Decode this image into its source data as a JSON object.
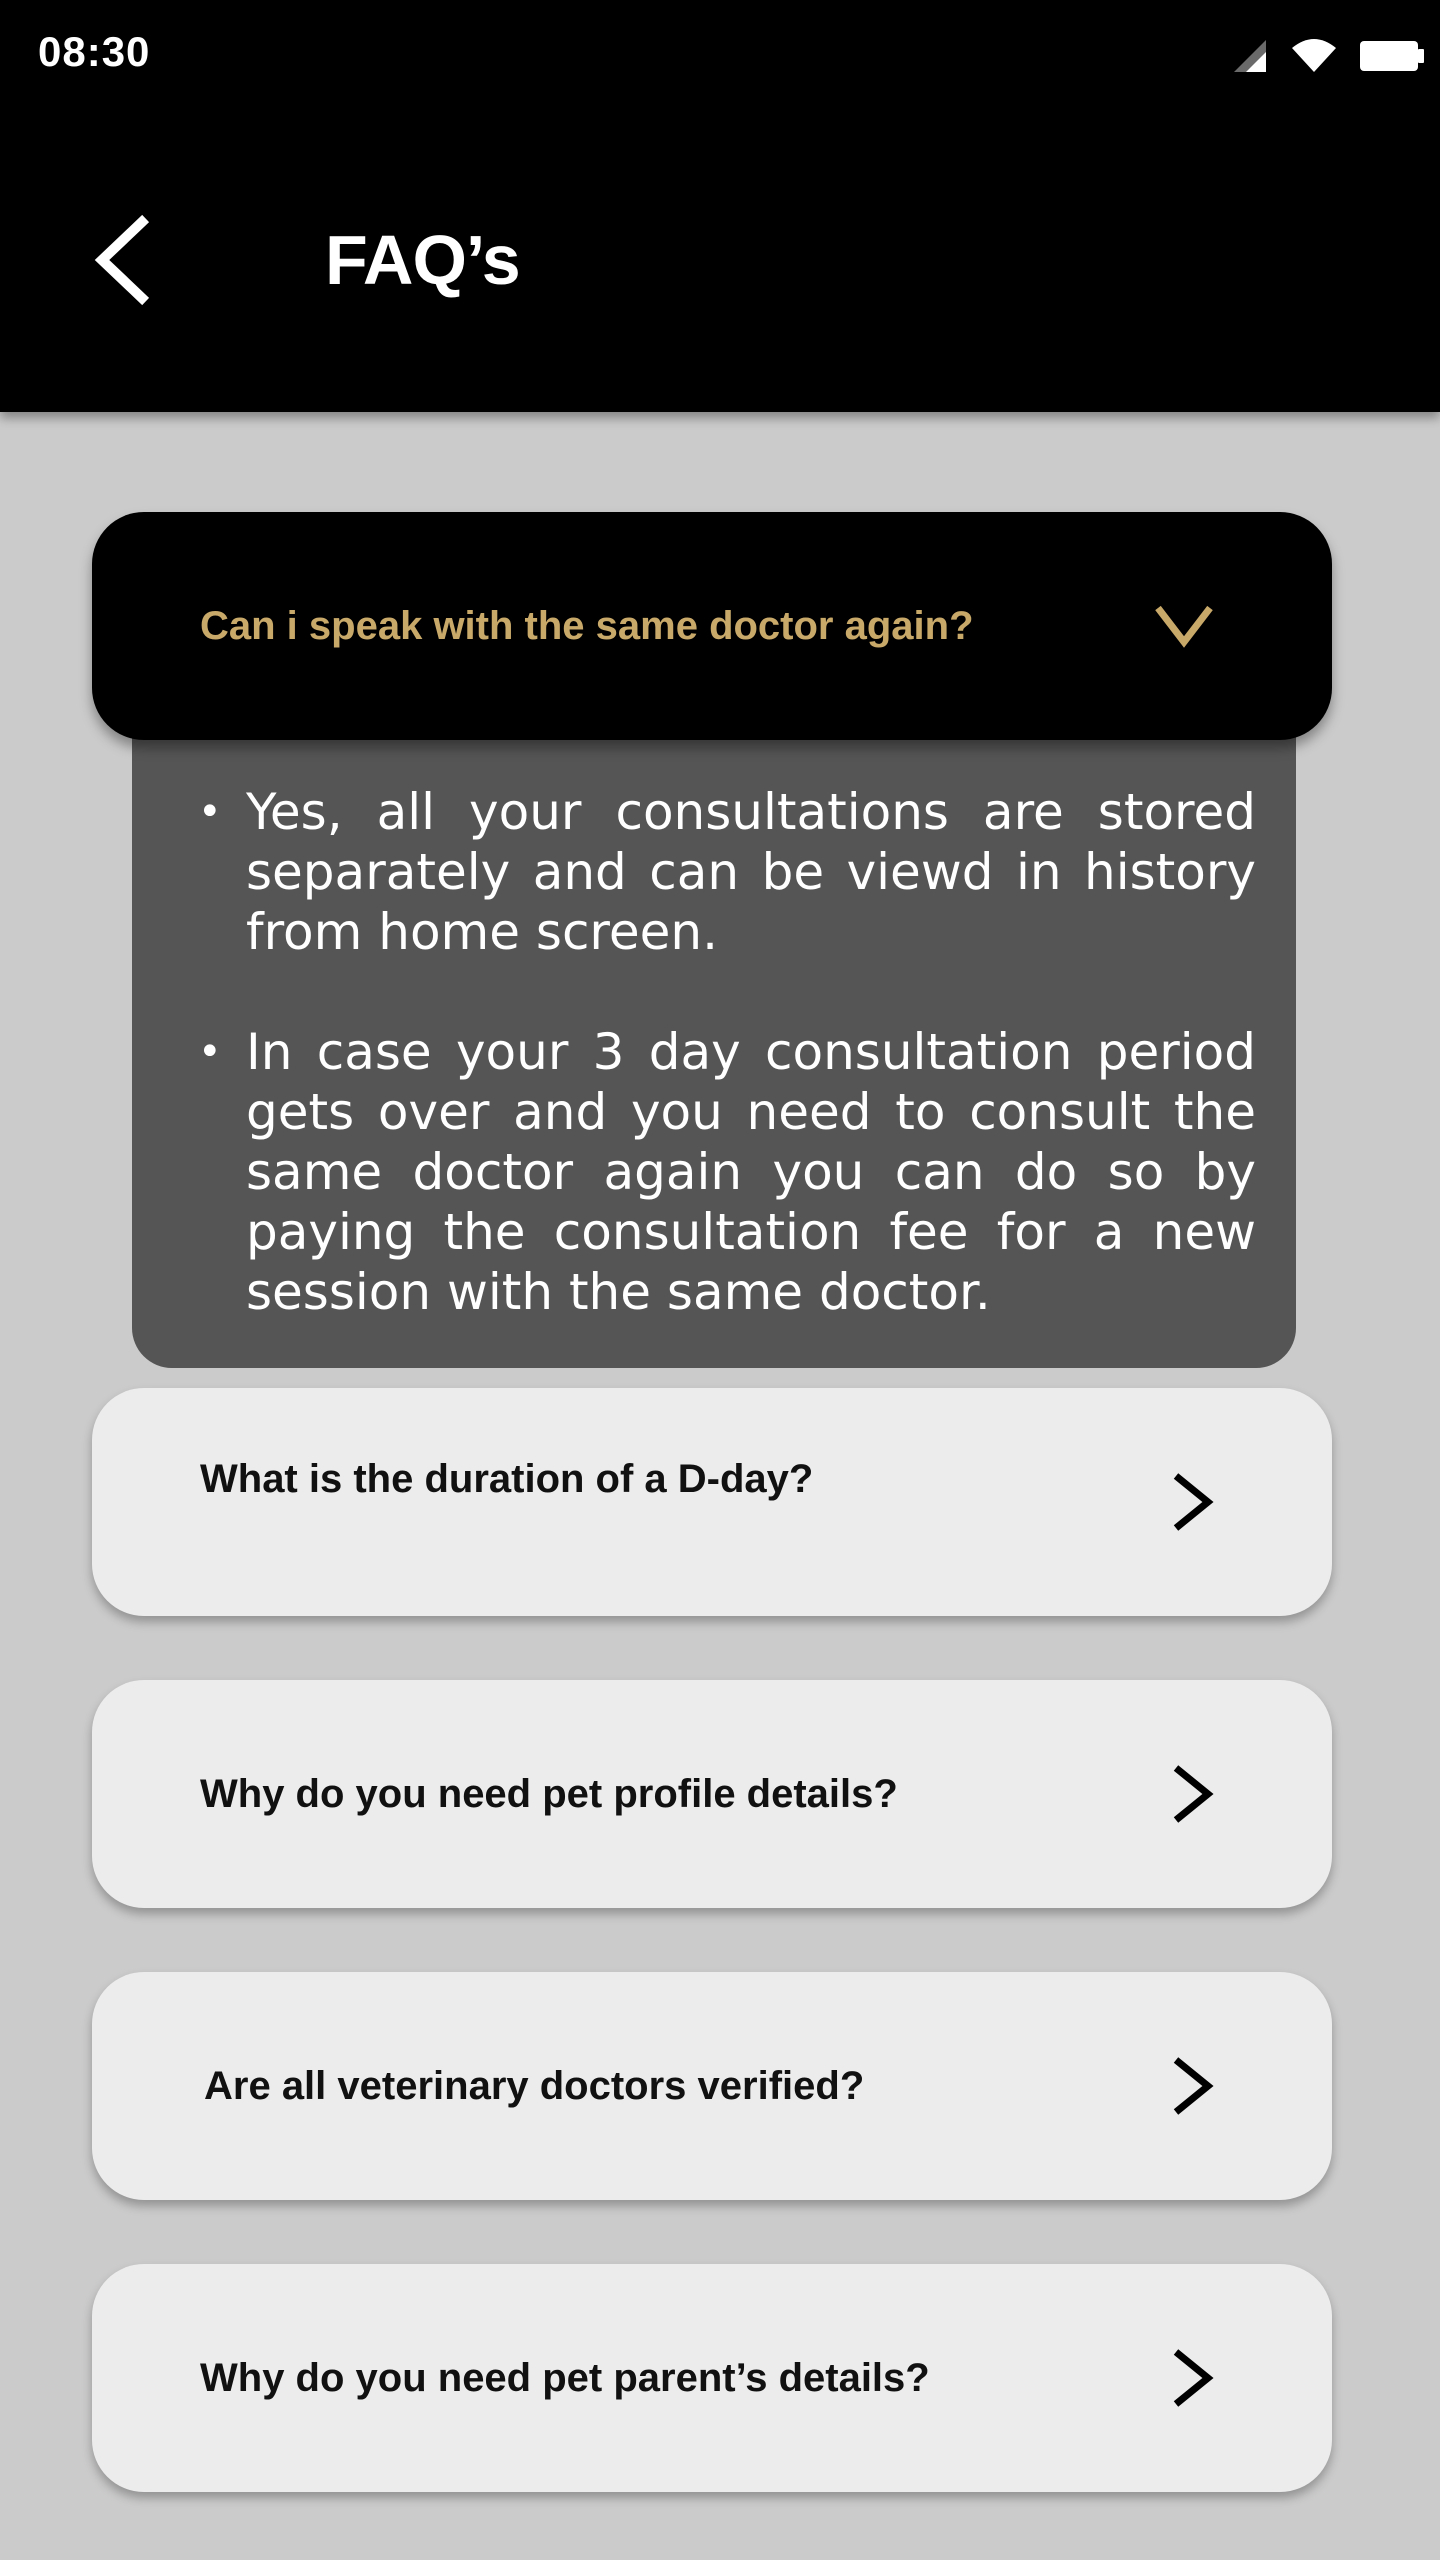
{
  "status_bar": {
    "time": "08:30"
  },
  "header": {
    "title": "FAQ’s"
  },
  "faqs": [
    {
      "question": "Can i speak with the same doctor again?",
      "expanded": true,
      "answers": [
        "Yes, all your consultations are stored separately and can be viewd in history from home screen.",
        "In case your 3 day consultation period gets over and you need to consult the same doctor again you can do so by paying the consultation fee for a new session with the same doctor."
      ]
    },
    {
      "question": "What is the duration of a D-day?",
      "expanded": false
    },
    {
      "question": "Why do you need pet profile details?",
      "expanded": false
    },
    {
      "question": "Are all veterinary doctors verified?",
      "expanded": false
    },
    {
      "question": "Why do you need pet parent’s details?",
      "expanded": false
    }
  ],
  "colors": {
    "background": "#cbcbcb",
    "header": "#000000",
    "accent_gold": "#c9a96a",
    "answer_panel": "#555555",
    "card": "#ececec"
  }
}
